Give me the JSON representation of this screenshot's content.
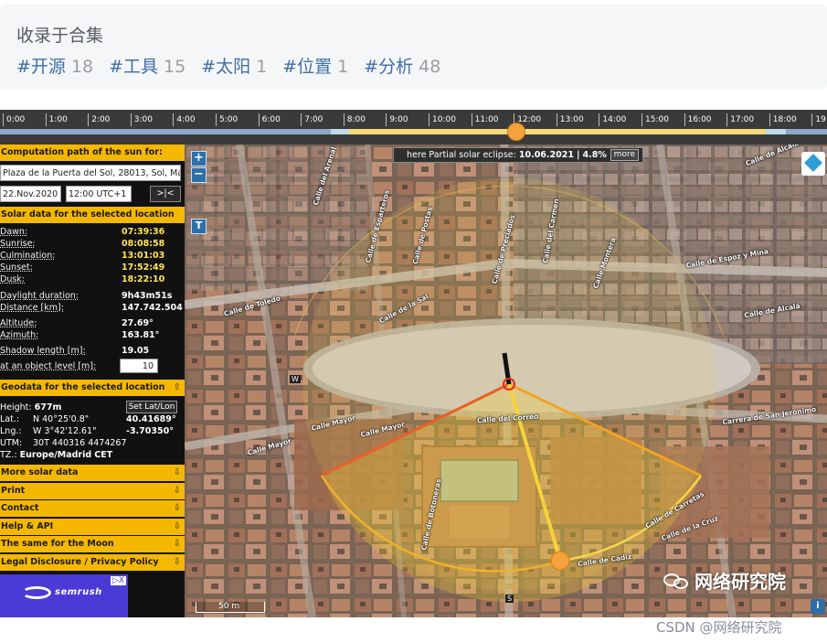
{
  "collection": {
    "title": "收录于合集",
    "tags": [
      {
        "label": "#开源",
        "count": "18"
      },
      {
        "label": "#工具",
        "count": "15"
      },
      {
        "label": "#太阳",
        "count": "1"
      },
      {
        "label": "#位置",
        "count": "1"
      },
      {
        "label": "#分析",
        "count": "48"
      }
    ]
  },
  "timeline": {
    "hours": [
      "0:00",
      "1:00",
      "2:00",
      "3:00",
      "4:00",
      "5:00",
      "6:00",
      "7:00",
      "8:00",
      "9:00",
      "10:00",
      "11:00",
      "12:00",
      "13:00",
      "14:00",
      "15:00",
      "16:00",
      "17:00",
      "18:00",
      "19"
    ],
    "colors": {
      "night": "#8da6c9",
      "twilight": "#bfd9ea",
      "day": "#f4da7a",
      "thumb": "#f4a23c"
    }
  },
  "sidebar": {
    "computation_header": "Computation path of the sun for:",
    "address": "Plaza de la Puerta del Sol, 28013, Sol, Madrid",
    "date": "22.Nov.2020",
    "time": "12:00 UTC+1",
    "now_button": ">|<",
    "solar_header": "Solar data for the selected location",
    "solar_rows": [
      {
        "label": "Dawn:",
        "value": "07:39:36"
      },
      {
        "label": "Sunrise:",
        "value": "08:08:58"
      },
      {
        "label": "Culmination:",
        "value": "13:01:03"
      },
      {
        "label": "Sunset:",
        "value": "17:52:49"
      },
      {
        "label": "Dusk:",
        "value": "18:22:10"
      },
      {
        "label": "Daylight duration:",
        "value": "9h43m51s"
      },
      {
        "label": "Distance [km]:",
        "value": "147.742.504"
      },
      {
        "label": "Altitude:",
        "value": "27.69°"
      },
      {
        "label": "Azimuth:",
        "value": "163.81°"
      },
      {
        "label": "Shadow length [m]:",
        "value": "19.05"
      },
      {
        "label": "at an object level [m]:",
        "value": "10"
      }
    ],
    "geo_header": "Geodata for the selected location",
    "height_label": "Height:",
    "height_value": "677m",
    "set_button": "Set Lat/Lon",
    "lat_label": "Lat.:",
    "lat_dms": "N 40°25'0.8\"",
    "lat_dec": "40.41689°",
    "lng_label": "Lng.:",
    "lng_dms": "W 3°42'12.61\"",
    "lng_dec": "-3.70350°",
    "utm_label": "UTM:",
    "utm_value": "30T 440316 4474267",
    "tz_label": "TZ.:",
    "tz_value": "Europe/Madrid",
    "tz_abbr": "CET",
    "menu": [
      "More solar data",
      "Print",
      "Contact",
      "Help & API",
      "The same for the Moon",
      "Legal Disclosure / Privacy Policy"
    ],
    "ad_brand": "semrush",
    "ad_close": "▷X"
  },
  "map": {
    "eclipse_prefix": "here Partial solar eclipse:",
    "eclipse_date": "10.06.2021",
    "eclipse_pct": "4.8%",
    "more": "more",
    "zoom_in": "+",
    "zoom_out": "−",
    "tool_t": "T",
    "scale": "50 m",
    "info": "i",
    "streets": [
      "Calle de Toledo",
      "Calle de la Sal",
      "Calle Mayor",
      "Calle Mayor",
      "Calle Mayor",
      "Calle del Arenal",
      "Calle de Alcalá",
      "Calle de Alcalá",
      "Carrera de San Jerónimo",
      "Calle de Postas",
      "Calle de Esparteros",
      "Calle de Carretas",
      "Calle de la Cruz",
      "Calle del Correo",
      "Calle Montera",
      "Calle de Preciados",
      "Calle del Carmen",
      "Calle de Botoneras",
      "Calle de Cádiz",
      "Calle de Espoz y Mina"
    ],
    "compass": [
      "W",
      "S"
    ]
  },
  "watermarks": {
    "overlay": "网络研究院",
    "footer": "CSDN @网络研究院"
  }
}
